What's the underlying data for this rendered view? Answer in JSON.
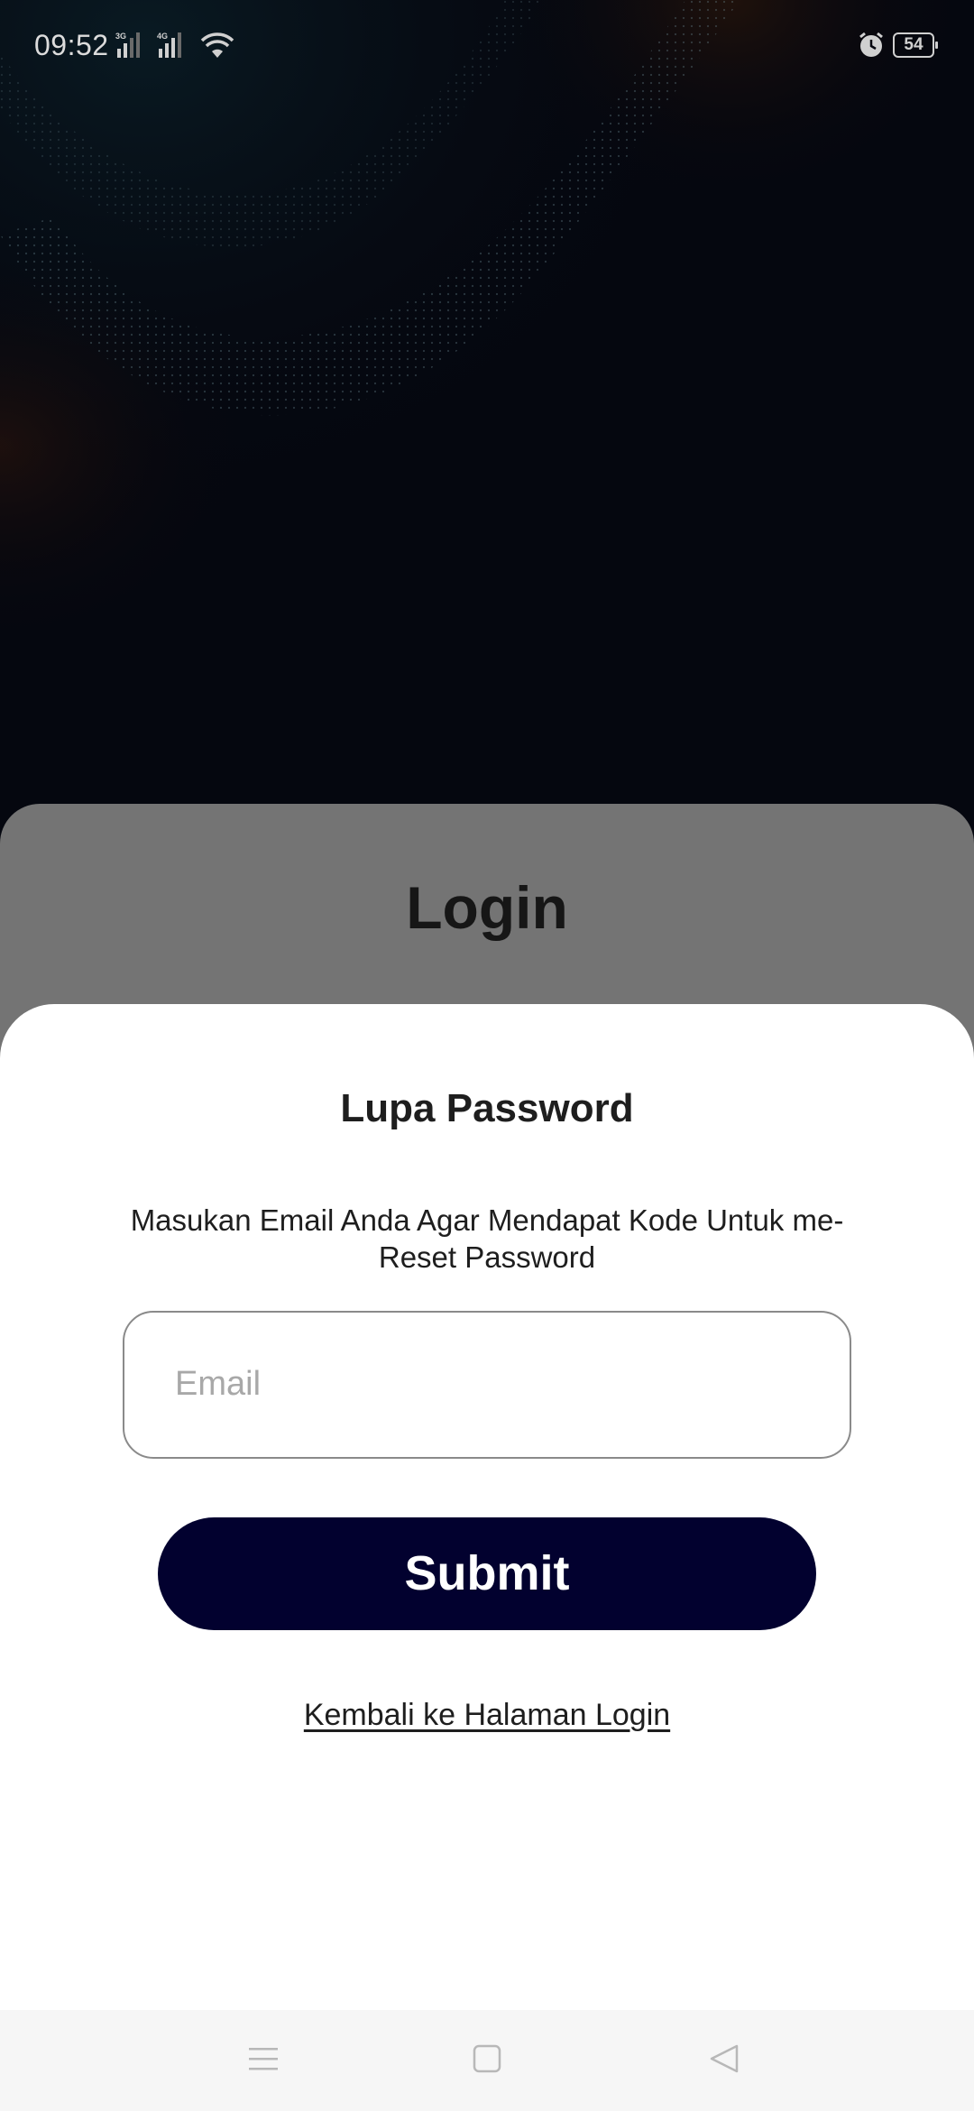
{
  "status_bar": {
    "time": "09:52",
    "network_1": "3G",
    "network_2": "4G",
    "battery_level": "54"
  },
  "login_card": {
    "title": "Login"
  },
  "forgot_sheet": {
    "title": "Lupa Password",
    "description": "Masukan Email Anda Agar Mendapat Kode Untuk me-Reset Password",
    "email_placeholder": "Email",
    "email_value": "",
    "submit_label": "Submit",
    "back_link_label": "Kembali ke Halaman Login"
  },
  "nav_bar": {
    "items": [
      "menu-icon",
      "home-icon",
      "back-icon"
    ]
  },
  "colors": {
    "primary": "#02012f",
    "background_dark": "#05070f",
    "sheet": "#ffffff",
    "scrim_card": "#747474"
  }
}
